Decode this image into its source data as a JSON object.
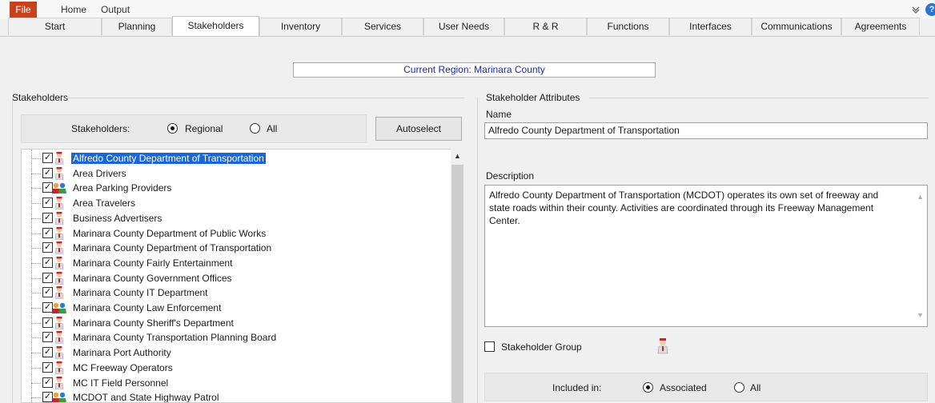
{
  "menu": {
    "file": "File",
    "home": "Home",
    "output": "Output"
  },
  "tabs": [
    {
      "label": "Start"
    },
    {
      "label": "Planning"
    },
    {
      "label": "Stakeholders"
    },
    {
      "label": "Inventory"
    },
    {
      "label": "Services"
    },
    {
      "label": "User Needs"
    },
    {
      "label": "R & R"
    },
    {
      "label": "Functions"
    },
    {
      "label": "Interfaces"
    },
    {
      "label": "Communications"
    },
    {
      "label": "Agreements"
    }
  ],
  "active_tab": "Stakeholders",
  "region": "Current Region: Marinara County",
  "left": {
    "group_title": "Stakeholders",
    "filter_label": "Stakeholders:",
    "radio_regional": "Regional",
    "radio_all": "All",
    "filter_selected": "Regional",
    "autoselect": "Autoselect",
    "items": [
      {
        "label": "Alfredo County Department of Transportation",
        "icon": "person-icon",
        "checked": true,
        "selected": true
      },
      {
        "label": "Area Drivers",
        "icon": "person-icon",
        "checked": true
      },
      {
        "label": "Area Parking Providers",
        "icon": "group-icon",
        "checked": true
      },
      {
        "label": "Area Travelers",
        "icon": "person-icon",
        "checked": true
      },
      {
        "label": "Business Advertisers",
        "icon": "person-icon",
        "checked": true
      },
      {
        "label": "Marinara County Department of Public Works",
        "icon": "person-icon",
        "checked": true
      },
      {
        "label": "Marinara County Department of Transportation",
        "icon": "person-icon",
        "checked": true
      },
      {
        "label": "Marinara County Fairly Entertainment",
        "icon": "person-icon",
        "checked": true
      },
      {
        "label": "Marinara County Government Offices",
        "icon": "person-icon",
        "checked": true
      },
      {
        "label": "Marinara County IT Department",
        "icon": "person-icon",
        "checked": true
      },
      {
        "label": "Marinara County Law Enforcement",
        "icon": "group-icon",
        "checked": true
      },
      {
        "label": "Marinara County Sheriff's Department",
        "icon": "person-icon",
        "checked": true
      },
      {
        "label": "Marinara County Transportation Planning Board",
        "icon": "person-icon",
        "checked": true
      },
      {
        "label": "Marinara Port Authority",
        "icon": "person-icon",
        "checked": true
      },
      {
        "label": "MC Freeway Operators",
        "icon": "person-icon",
        "checked": true
      },
      {
        "label": "MC IT Field Personnel",
        "icon": "person-icon",
        "checked": true
      },
      {
        "label": "MCDOT and State Highway Patrol",
        "icon": "group-icon",
        "checked": true
      }
    ]
  },
  "right": {
    "group_title": "Stakeholder Attributes",
    "name_label": "Name",
    "name_value": "Alfredo County Department of Transportation",
    "desc_label": "Description",
    "desc_value": "Alfredo County Department of Transportation (MCDOT) operates its own set of freeway and state roads within their county. Activities are coordinated through its Freeway Management Center.",
    "group_checkbox_label": "Stakeholder Group",
    "included_label": "Included in:",
    "radio_associated": "Associated",
    "radio_all": "All",
    "included_selected": "Associated"
  },
  "colors": {
    "file_tab": "#c9411b",
    "selection": "#1a67d4",
    "region_text": "#1c2aa6"
  }
}
